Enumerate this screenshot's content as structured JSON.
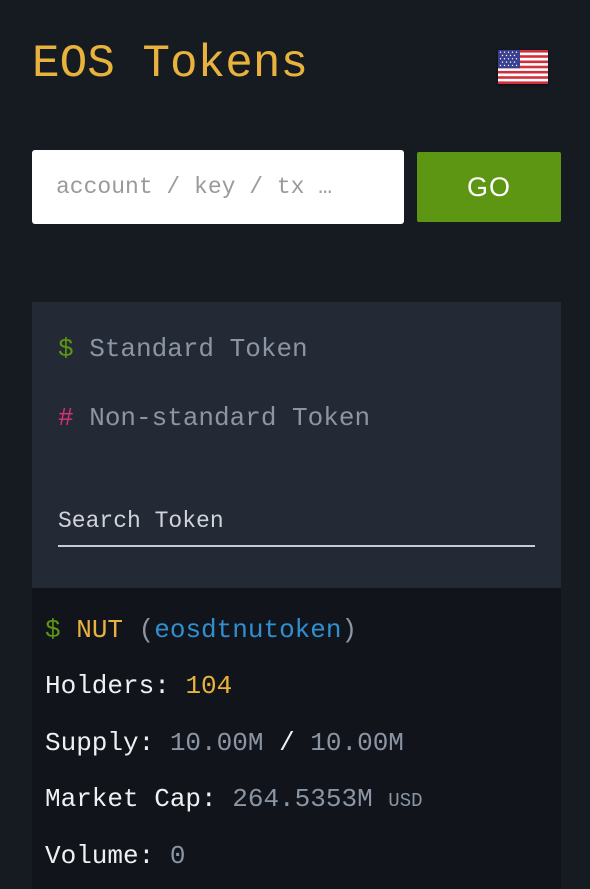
{
  "header": {
    "title": "EOS Tokens",
    "language_flag": "us-flag-icon"
  },
  "search": {
    "placeholder": "account / key / tx …",
    "go_label": "GO"
  },
  "filters": {
    "standard_symbol": "$",
    "standard_label": "Standard Token",
    "nonstandard_symbol": "#",
    "nonstandard_label": "Non-standard Token",
    "search_placeholder": "Search Token"
  },
  "token": {
    "type_symbol": "$",
    "symbol": "NUT",
    "open_paren": "(",
    "contract": "eosdtnutoken",
    "close_paren": ")",
    "holders_label": "Holders:",
    "holders_value": "104",
    "supply_label": "Supply:",
    "supply_current": "10.00M",
    "supply_separator": "/",
    "supply_max": "10.00M",
    "market_cap_label": "Market Cap:",
    "market_cap_value": "264.5353M",
    "market_cap_currency": "USD",
    "volume_label": "Volume:",
    "volume_value": "0"
  },
  "colors": {
    "background": "#161a21",
    "accent_yellow": "#e8b23c",
    "go_green": "#5c9613",
    "link_blue": "#2f8fd0",
    "nonstandard_pink": "#d6337a",
    "panel": "#242a35"
  }
}
